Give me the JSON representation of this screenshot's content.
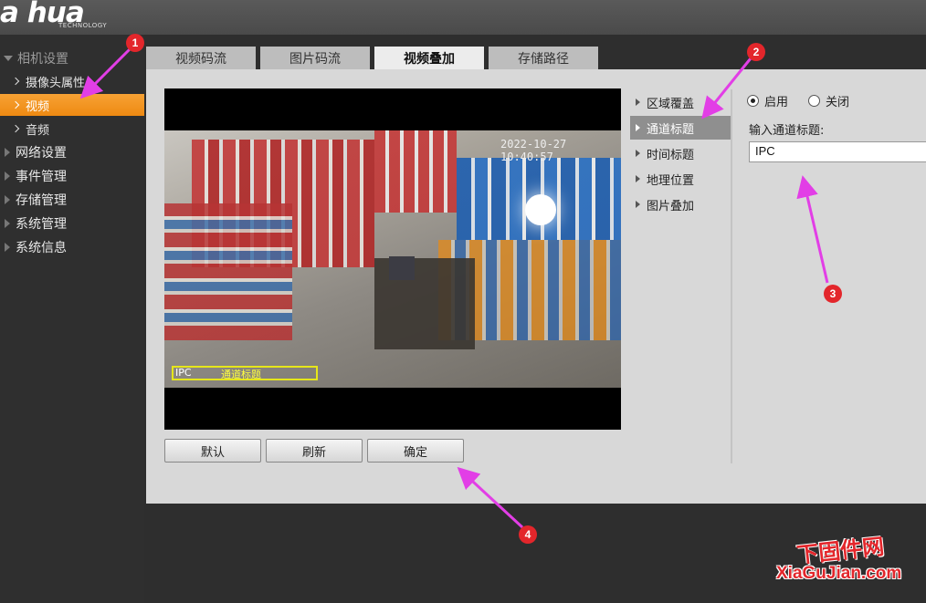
{
  "brand": {
    "logo": "a hua",
    "sub": "TECHNOLOGY"
  },
  "sidebar": {
    "group": "相机设置",
    "sub_items": [
      "摄像头属性",
      "视频",
      "音频"
    ],
    "items": [
      "网络设置",
      "事件管理",
      "存储管理",
      "系统管理",
      "系统信息"
    ]
  },
  "tabs": [
    "视频码流",
    "图片码流",
    "视频叠加",
    "存储路径"
  ],
  "active_tab": "视频叠加",
  "video": {
    "timestamp": "2022-10-27 10:40:57",
    "osd_channel": "IPC",
    "osd_title": "通道标题"
  },
  "overlay_menu": [
    "区域覆盖",
    "通道标题",
    "时间标题",
    "地理位置",
    "图片叠加"
  ],
  "active_overlay": "通道标题",
  "settings": {
    "enable_label": "启用",
    "disable_label": "关闭",
    "enabled": true,
    "input_label": "输入通道标题:",
    "input_value": "IPC"
  },
  "buttons": {
    "default": "默认",
    "refresh": "刷新",
    "ok": "确定"
  },
  "annotations": [
    "1",
    "2",
    "3",
    "4"
  ],
  "watermark": {
    "line1": "下固件网",
    "line2": "XiaGuJian.com"
  },
  "colors": {
    "accent": "#f59a23",
    "annotation": "#e3262b",
    "arrow": "#e23ee6"
  }
}
